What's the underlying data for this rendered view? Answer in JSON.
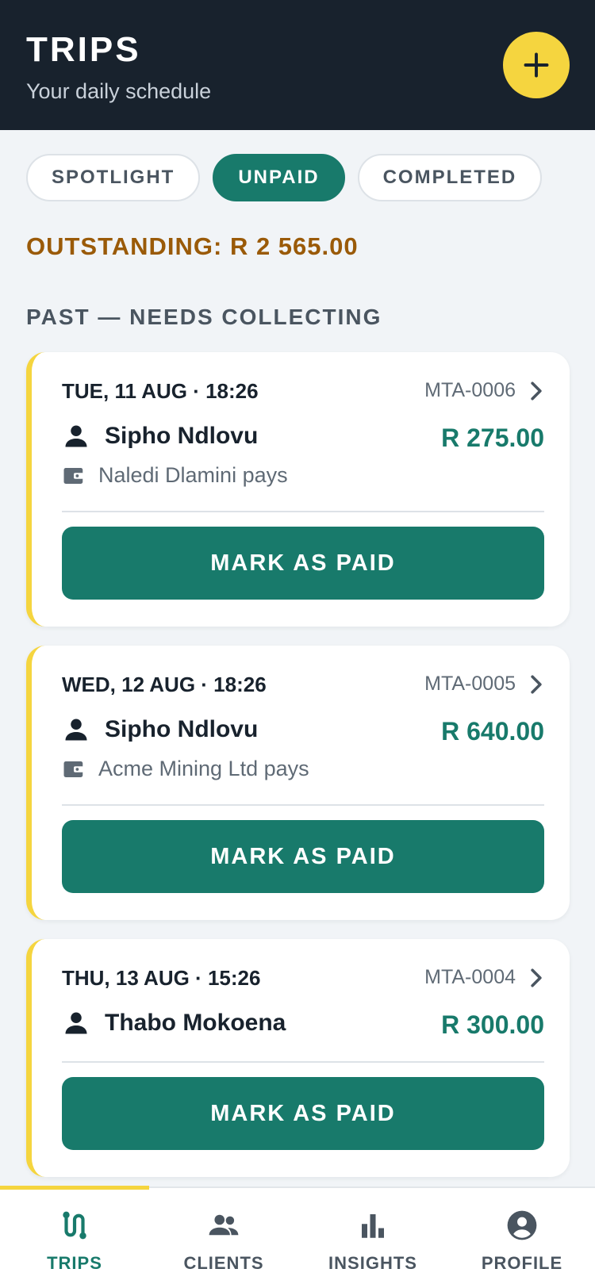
{
  "header": {
    "title": "TRIPS",
    "subtitle": "Your daily schedule",
    "add_icon": "plus-icon"
  },
  "tabs": [
    {
      "label": "SPOTLIGHT",
      "active": false
    },
    {
      "label": "UNPAID",
      "active": true
    },
    {
      "label": "COMPLETED",
      "active": false
    }
  ],
  "outstanding": "OUTSTANDING: R 2 565.00",
  "section_label": "PAST — NEEDS COLLECTING",
  "trips": [
    {
      "date": "TUE, 11 AUG · 18:26",
      "ref": "MTA-0006",
      "client": "Sipho Ndlovu",
      "amount": "R 275.00",
      "payer": "Naledi Dlamini pays",
      "button": "MARK AS PAID"
    },
    {
      "date": "WED, 12 AUG · 18:26",
      "ref": "MTA-0005",
      "client": "Sipho Ndlovu",
      "amount": "R 640.00",
      "payer": "Acme Mining Ltd pays",
      "button": "MARK AS PAID"
    },
    {
      "date": "THU, 13 AUG · 15:26",
      "ref": "MTA-0004",
      "client": "Thabo Mokoena",
      "amount": "R 300.00",
      "button": "MARK AS PAID"
    }
  ],
  "nav": [
    {
      "label": "TRIPS",
      "icon": "route-icon",
      "active": true
    },
    {
      "label": "CLIENTS",
      "icon": "people-icon",
      "active": false
    },
    {
      "label": "INSIGHTS",
      "icon": "bar-chart-icon",
      "active": false
    },
    {
      "label": "PROFILE",
      "icon": "account-circle-icon",
      "active": false
    }
  ],
  "colors": {
    "header_bg": "#18222d",
    "accent_yellow": "#f5d53f",
    "primary_green": "#187a6b",
    "outstanding_brown": "#9a5a08",
    "page_bg": "#f1f4f7"
  }
}
